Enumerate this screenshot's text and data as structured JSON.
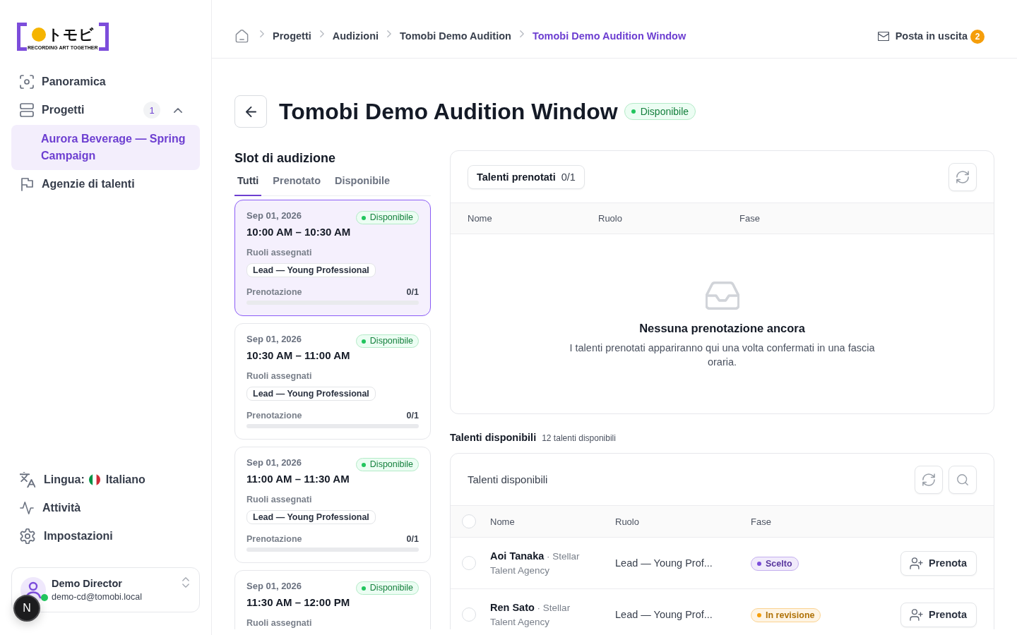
{
  "sidebar": {
    "logo": {
      "mark": "トモビ",
      "tagline": "RECORDING ART TOGETHER"
    },
    "nav": [
      {
        "kind": "overview",
        "label": "Panoramica",
        "selected": false
      },
      {
        "kind": "projects",
        "label": "Progetti",
        "selected": false,
        "count": "1",
        "expanded": true,
        "children": [
          {
            "label": "Aurora Beverage — Spring Campaign",
            "selected": true
          }
        ]
      },
      {
        "kind": "agencies",
        "label": "Agenzie di talenti",
        "selected": false
      }
    ],
    "footer_nav": [
      {
        "kind": "language",
        "label": "Lingua:",
        "value": "Italiano"
      },
      {
        "kind": "activity",
        "label": "Attività"
      },
      {
        "kind": "settings",
        "label": "Impostazioni"
      }
    ],
    "user": {
      "name": "Demo Director",
      "email": "demo-cd@tomobi.local",
      "online": true
    }
  },
  "dev_indicator": {
    "label": "N"
  },
  "header": {
    "breadcrumb": [
      {
        "label": "Progetti",
        "current": false
      },
      {
        "label": "Audizioni",
        "current": false
      },
      {
        "label": "Tomobi Demo Audition",
        "current": false
      },
      {
        "label": "Tomobi Demo Audition Window",
        "current": true
      }
    ],
    "outbox": {
      "label": "Posta in uscita",
      "count": "2"
    }
  },
  "page": {
    "title": "Tomobi Demo Audition Window",
    "status": {
      "label": "Disponibile",
      "kind": "available"
    }
  },
  "slots": {
    "heading": "Slot di audizione",
    "tabs": [
      {
        "label": "Tutti",
        "selected": true
      },
      {
        "label": "Prenotato",
        "selected": false
      },
      {
        "label": "Disponibile",
        "selected": false
      }
    ],
    "items": [
      {
        "date": "Sep 01, 2026",
        "time": "10:00 AM – 10:30 AM",
        "status": {
          "label": "Disponibile",
          "kind": "available"
        },
        "roles_label": "Ruoli assegnati",
        "roles": [
          "Lead — Young Professional"
        ],
        "booking_label": "Prenotazione",
        "booking_count": "0/1",
        "level": 0,
        "selected": true
      },
      {
        "date": "Sep 01, 2026",
        "time": "10:30 AM – 11:00 AM",
        "status": {
          "label": "Disponibile",
          "kind": "available"
        },
        "roles_label": "Ruoli assegnati",
        "roles": [
          "Lead — Young Professional"
        ],
        "booking_label": "Prenotazione",
        "booking_count": "0/1",
        "level": 0,
        "selected": false
      },
      {
        "date": "Sep 01, 2026",
        "time": "11:00 AM – 11:30 AM",
        "status": {
          "label": "Disponibile",
          "kind": "available"
        },
        "roles_label": "Ruoli assegnati",
        "roles": [
          "Lead — Young Professional"
        ],
        "booking_label": "Prenotazione",
        "booking_count": "0/1",
        "level": 0,
        "selected": false
      },
      {
        "date": "Sep 01, 2026",
        "time": "11:30 AM – 12:00 PM",
        "status": {
          "label": "Disponibile",
          "kind": "available"
        },
        "roles_label": "Ruoli assegnati",
        "selected": false
      }
    ]
  },
  "booked": {
    "label": "Talenti prenotati",
    "count": "0/1",
    "columns": [
      "Nome",
      "Ruolo",
      "Fase"
    ],
    "empty": {
      "title": "Nessuna prenotazione ancora",
      "text": "I talenti prenotati appariranno qui una volta confermati in una fascia oraria."
    }
  },
  "available": {
    "heading": "Talenti disponibili",
    "count": "12 talenti disponibili",
    "panel_title": "Talenti disponibili",
    "select_all": {
      "checked": false
    },
    "columns": [
      "Nome",
      "Ruolo",
      "Fase"
    ],
    "rows": [
      {
        "checked": false,
        "name": "Aoi Tanaka",
        "agency": "· Stellar Talent Agency",
        "role": "Lead — Young Prof...",
        "phase": {
          "label": "Scelto",
          "color": "#7c4ddb"
        },
        "action": "Prenota"
      },
      {
        "checked": false,
        "name": "Ren Sato",
        "agency": "· Stellar Talent Agency",
        "role": "Lead — Young Prof...",
        "phase": {
          "label": "In revisione",
          "color": "#f59e0b"
        },
        "action": "Prenota"
      }
    ]
  }
}
